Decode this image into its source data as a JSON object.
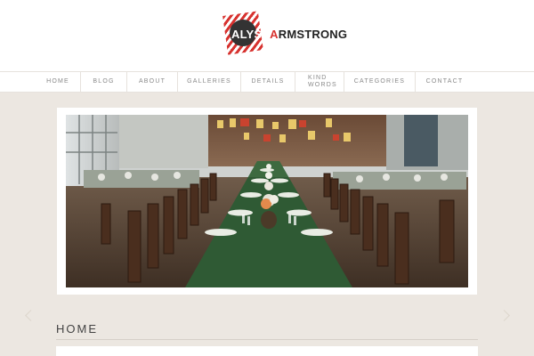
{
  "logo": {
    "part1": "ALYSS",
    "part2": "A",
    "part3": "RMSTRONG"
  },
  "nav": {
    "items": [
      {
        "label": "HOME"
      },
      {
        "label": "BLOG"
      },
      {
        "label": "ABOUT"
      },
      {
        "label": "GALLERIES"
      },
      {
        "label": "DETAILS"
      },
      {
        "label": "KIND WORDS"
      },
      {
        "label": "CATEGORIES"
      },
      {
        "label": "CONTACT"
      }
    ]
  },
  "page": {
    "title": "HOME"
  },
  "colors": {
    "accent": "#d7322f",
    "background": "#ece7e1",
    "tablecloth": "#2f5a34"
  },
  "photo": {
    "subject": "banquet-table-image"
  }
}
